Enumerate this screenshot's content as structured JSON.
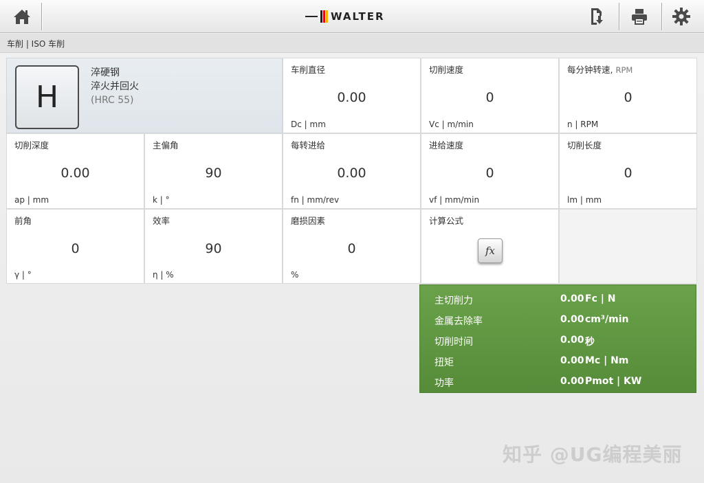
{
  "header": {
    "logo_text": "WALTER",
    "brand_colors": [
      "#e30613",
      "#f7b500",
      "#222222"
    ]
  },
  "breadcrumb": "车削 | ISO 车削",
  "material": {
    "group": "H",
    "name": "淬硬钢",
    "treatment": "淬火并回火",
    "hardness": "(HRC 55)"
  },
  "fields": {
    "dc": {
      "label": "车削直径",
      "value": "0.00",
      "unit": "Dc | mm"
    },
    "vc": {
      "label": "切削速度",
      "value": "0",
      "unit": "Vc | m/min"
    },
    "n": {
      "label": "每分钟转速",
      "label_suffix": "RPM",
      "value": "0",
      "unit": "n | RPM"
    },
    "ap": {
      "label": "切削深度",
      "value": "0.00",
      "unit": "ap | mm"
    },
    "k": {
      "label": "主偏角",
      "value": "90",
      "unit": "k | °"
    },
    "fn": {
      "label": "每转进给",
      "value": "0.00",
      "unit": "fn | mm/rev"
    },
    "vf": {
      "label": "进给速度",
      "value": "0",
      "unit": "vf | mm/min"
    },
    "lm": {
      "label": "切削长度",
      "value": "0",
      "unit": "lm | mm"
    },
    "gamma": {
      "label": "前角",
      "value": "0",
      "unit": "γ | °"
    },
    "eta": {
      "label": "效率",
      "value": "90",
      "unit": "η | %"
    },
    "wear": {
      "label": "磨损因素",
      "value": "0",
      "unit": "%"
    },
    "formula": {
      "label": "计算公式",
      "button": "fx"
    }
  },
  "results": [
    {
      "label": "主切削力",
      "value": "0.00",
      "unit": "Fc | N"
    },
    {
      "label": "金属去除率",
      "value": "0.00",
      "unit": "cm³/min"
    },
    {
      "label": "切削时间",
      "value": "0.00",
      "unit": "秒"
    },
    {
      "label": "扭矩",
      "value": "0.00",
      "unit": "Mc | Nm"
    },
    {
      "label": "功率",
      "value": "0.00",
      "unit": "Pmot | KW"
    }
  ],
  "icons": {
    "home": "home-icon",
    "export": "export-icon",
    "print": "printer-icon",
    "settings": "gear-icon"
  },
  "results_color": "#5f9742",
  "watermark": "知乎 @UG编程美丽"
}
